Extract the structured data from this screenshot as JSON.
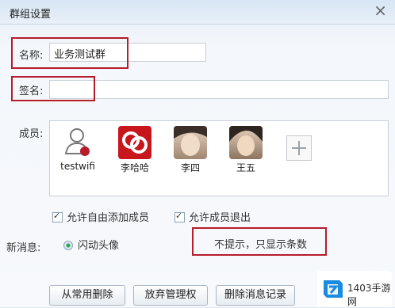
{
  "window": {
    "title": "群组设置",
    "close_symbol": "×"
  },
  "form": {
    "name_label": "名称:",
    "name_value": "业务测试群",
    "sign_label": "签名:",
    "sign_value": ""
  },
  "members": {
    "label": "成员:",
    "items": [
      {
        "name": "testwifi",
        "avatar": "user-silhouette-icon"
      },
      {
        "name": "李哈哈",
        "avatar": "red-swirl-avatar"
      },
      {
        "name": "李四",
        "avatar": "portrait-avatar"
      },
      {
        "name": "王五",
        "avatar": "portrait-avatar"
      }
    ],
    "add_icon": "plus-icon"
  },
  "permissions": {
    "allow_add": "允许自由添加成员",
    "allow_exit": "允许成员退出"
  },
  "new_message": {
    "label": "新消息:",
    "selected": "闪动头像",
    "other_option": "不提示，只显示条数"
  },
  "buttons": {
    "remove_common": "从常用删除",
    "give_up_admin": "放弃管理权",
    "delete_record": "删除消息记录"
  },
  "branding": {
    "text": "1403手游网"
  },
  "colors": {
    "accent_red": "#b51d2d",
    "radio_green": "#2ca85c"
  }
}
